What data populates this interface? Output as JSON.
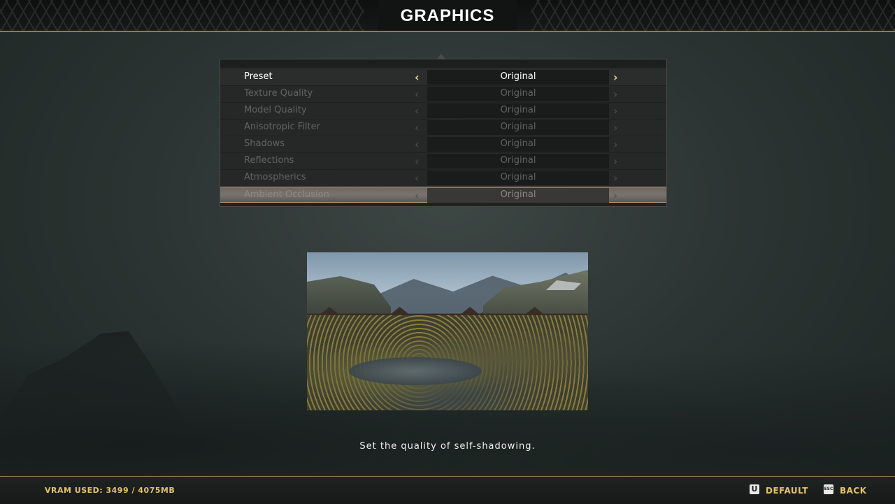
{
  "header": {
    "title": "GRAPHICS"
  },
  "settings": [
    {
      "label": "Preset",
      "value": "Original",
      "state": "active"
    },
    {
      "label": "Texture Quality",
      "value": "Original",
      "state": "disabled"
    },
    {
      "label": "Model Quality",
      "value": "Original",
      "state": "disabled"
    },
    {
      "label": "Anisotropic Filter",
      "value": "Original",
      "state": "disabled"
    },
    {
      "label": "Shadows",
      "value": "Original",
      "state": "disabled"
    },
    {
      "label": "Reflections",
      "value": "Original",
      "state": "disabled"
    },
    {
      "label": "Atmospherics",
      "value": "Original",
      "state": "disabled"
    },
    {
      "label": "Ambient Occlusion",
      "value": "Original",
      "state": "highlighted"
    }
  ],
  "arrows": {
    "left": "‹",
    "right": "›"
  },
  "description": "Set the quality of self-shadowing.",
  "footer": {
    "vram": "VRAM USED: 3499 / 4075MB",
    "default_key": "U",
    "default_label": "DEFAULT",
    "back_key": "ESC",
    "back_label": "BACK"
  },
  "colors": {
    "accent": "#e4c36a",
    "divider": "#8a7a5e"
  }
}
